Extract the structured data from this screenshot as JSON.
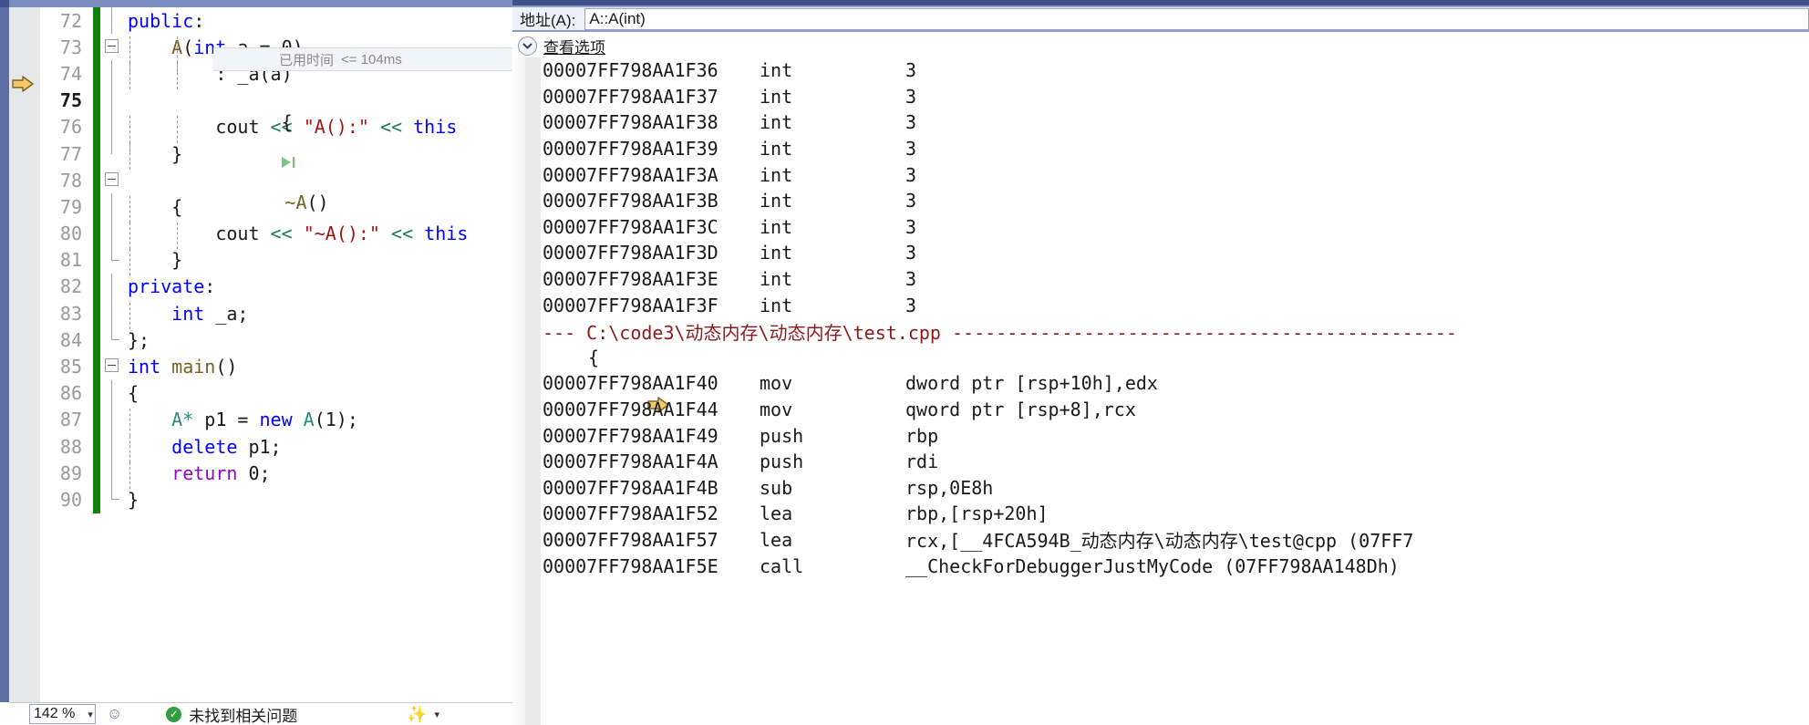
{
  "editor": {
    "zoom_level": "142 %",
    "status_message": "未找到相关问题",
    "codelens": {
      "label": "已用时间",
      "value": "<= 104ms"
    },
    "lines": [
      {
        "num": "72",
        "text": "public:"
      },
      {
        "num": "73",
        "text": "A(int a = 0)"
      },
      {
        "num": "74",
        "text": ": _a(a)"
      },
      {
        "num": "75",
        "text": "{"
      },
      {
        "num": "76",
        "text": "cout << \"A():\" << this"
      },
      {
        "num": "77",
        "text": "}"
      },
      {
        "num": "78",
        "text": "~A()"
      },
      {
        "num": "79",
        "text": "{"
      },
      {
        "num": "80",
        "text": "cout << \"~A():\" << this"
      },
      {
        "num": "81",
        "text": "}"
      },
      {
        "num": "82",
        "text": "private:"
      },
      {
        "num": "83",
        "text": "int _a;"
      },
      {
        "num": "84",
        "text": "};"
      },
      {
        "num": "85",
        "text": "int main()"
      },
      {
        "num": "86",
        "text": "{"
      },
      {
        "num": "87",
        "text": "A* p1 = new A(1);"
      },
      {
        "num": "88",
        "text": "delete p1;"
      },
      {
        "num": "89",
        "text": "return 0;"
      },
      {
        "num": "90",
        "text": "}"
      }
    ]
  },
  "disassembly": {
    "address_label": "地址(A):",
    "address_value": "A::A(int)",
    "view_options_label": "查看选项",
    "source_file_header": "--- C:\\code3\\动态内存\\动态内存\\test.cpp ----------------------------------------------",
    "source_brace": "{",
    "rows": [
      {
        "kind": "asm",
        "address": "00007FF798AA1F36",
        "mnemonic": "int",
        "operands": "3",
        "current": false
      },
      {
        "kind": "asm",
        "address": "00007FF798AA1F37",
        "mnemonic": "int",
        "operands": "3",
        "current": false
      },
      {
        "kind": "asm",
        "address": "00007FF798AA1F38",
        "mnemonic": "int",
        "operands": "3",
        "current": false
      },
      {
        "kind": "asm",
        "address": "00007FF798AA1F39",
        "mnemonic": "int",
        "operands": "3",
        "current": false
      },
      {
        "kind": "asm",
        "address": "00007FF798AA1F3A",
        "mnemonic": "int",
        "operands": "3",
        "current": false
      },
      {
        "kind": "asm",
        "address": "00007FF798AA1F3B",
        "mnemonic": "int",
        "operands": "3",
        "current": false
      },
      {
        "kind": "asm",
        "address": "00007FF798AA1F3C",
        "mnemonic": "int",
        "operands": "3",
        "current": false
      },
      {
        "kind": "asm",
        "address": "00007FF798AA1F3D",
        "mnemonic": "int",
        "operands": "3",
        "current": false
      },
      {
        "kind": "asm",
        "address": "00007FF798AA1F3E",
        "mnemonic": "int",
        "operands": "3",
        "current": false
      },
      {
        "kind": "asm",
        "address": "00007FF798AA1F3F",
        "mnemonic": "int",
        "operands": "3",
        "current": false
      },
      {
        "kind": "file",
        "text": "--- C:\\code3\\动态内存\\动态内存\\test.cpp ----------------------------------------------"
      },
      {
        "kind": "source",
        "text": "{"
      },
      {
        "kind": "asm",
        "address": "00007FF798AA1F40",
        "mnemonic": "mov",
        "operands": "dword ptr [rsp+10h],edx",
        "current": true
      },
      {
        "kind": "asm",
        "address": "00007FF798AA1F44",
        "mnemonic": "mov",
        "operands": "qword ptr [rsp+8],rcx",
        "current": false
      },
      {
        "kind": "asm",
        "address": "00007FF798AA1F49",
        "mnemonic": "push",
        "operands": "rbp",
        "current": false
      },
      {
        "kind": "asm",
        "address": "00007FF798AA1F4A",
        "mnemonic": "push",
        "operands": "rdi",
        "current": false
      },
      {
        "kind": "asm",
        "address": "00007FF798AA1F4B",
        "mnemonic": "sub",
        "operands": "rsp,0E8h",
        "current": false
      },
      {
        "kind": "asm",
        "address": "00007FF798AA1F52",
        "mnemonic": "lea",
        "operands": "rbp,[rsp+20h]",
        "current": false
      },
      {
        "kind": "asm",
        "address": "00007FF798AA1F57",
        "mnemonic": "lea",
        "operands": "rcx,[__4FCA594B_动态内存\\动态内存\\test@cpp (07FF7",
        "current": false
      },
      {
        "kind": "asm",
        "address": "00007FF798AA1F5E",
        "mnemonic": "call",
        "operands": "__CheckForDebuggerJustMyCode (07FF798AA148Dh)",
        "current": false
      }
    ]
  },
  "colors": {
    "keyword": "#0000ff",
    "string": "#a31515",
    "type": "#2b91af",
    "function": "#795e26",
    "operator": "#1a7a5e",
    "changebar_green": "#108010",
    "file_header_red": "#8b1a1a",
    "titlebar_blue": "#41518c",
    "current_arrow_yellow": "#f5c66a"
  }
}
